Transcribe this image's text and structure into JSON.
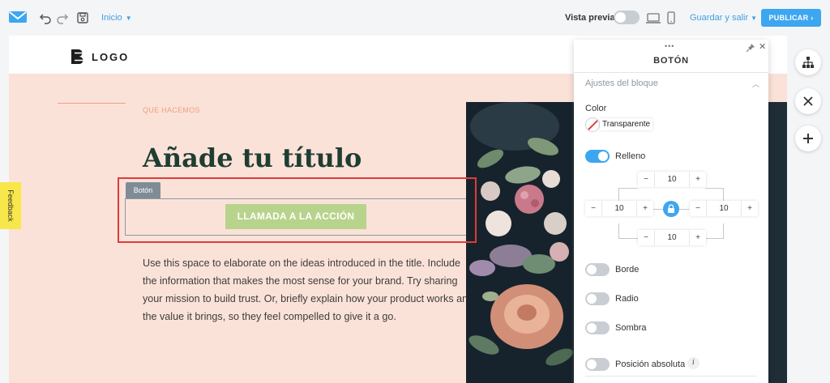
{
  "toolbar": {
    "page_selector": "Inicio",
    "preview_label": "Vista previa",
    "save_label": "Guardar y salir",
    "publish_label": "PUBLICAR ›"
  },
  "site": {
    "logo_text": "LOGO",
    "eyebrow": "QUE HACEMOS",
    "title": "Añade tu título",
    "block_tag": "Botón",
    "cta_label": "LLAMADA A LA ACCIÓN",
    "body": "Use this space to elaborate on the ideas introduced in the title. Include the information that makes the most sense for your brand. Try sharing your mission to build trust. Or, briefly explain how your product works and the value it brings, so they feel compelled to give it a go."
  },
  "feedback_label": "Feedback",
  "panel": {
    "title": "BOTÓN",
    "section_title": "Ajustes del bloque",
    "color_label": "Color",
    "color_value": "Transparente",
    "padding_label": "Relleno",
    "padding_enabled": true,
    "padding": {
      "top": "10",
      "left": "10",
      "right": "10",
      "bottom": "10"
    },
    "border_label": "Borde",
    "border_enabled": false,
    "radius_label": "Radio",
    "radius_enabled": false,
    "shadow_label": "Sombra",
    "shadow_enabled": false,
    "absolute_label": "Posición absoluta",
    "absolute_enabled": false,
    "info_symbol": "i"
  },
  "colors": {
    "accent": "#3da6f0",
    "highlight": "#e03b3b",
    "canvas_bg": "#fbe2d8",
    "cta_bg": "#b8d38c",
    "title_color": "#1f3d33"
  }
}
